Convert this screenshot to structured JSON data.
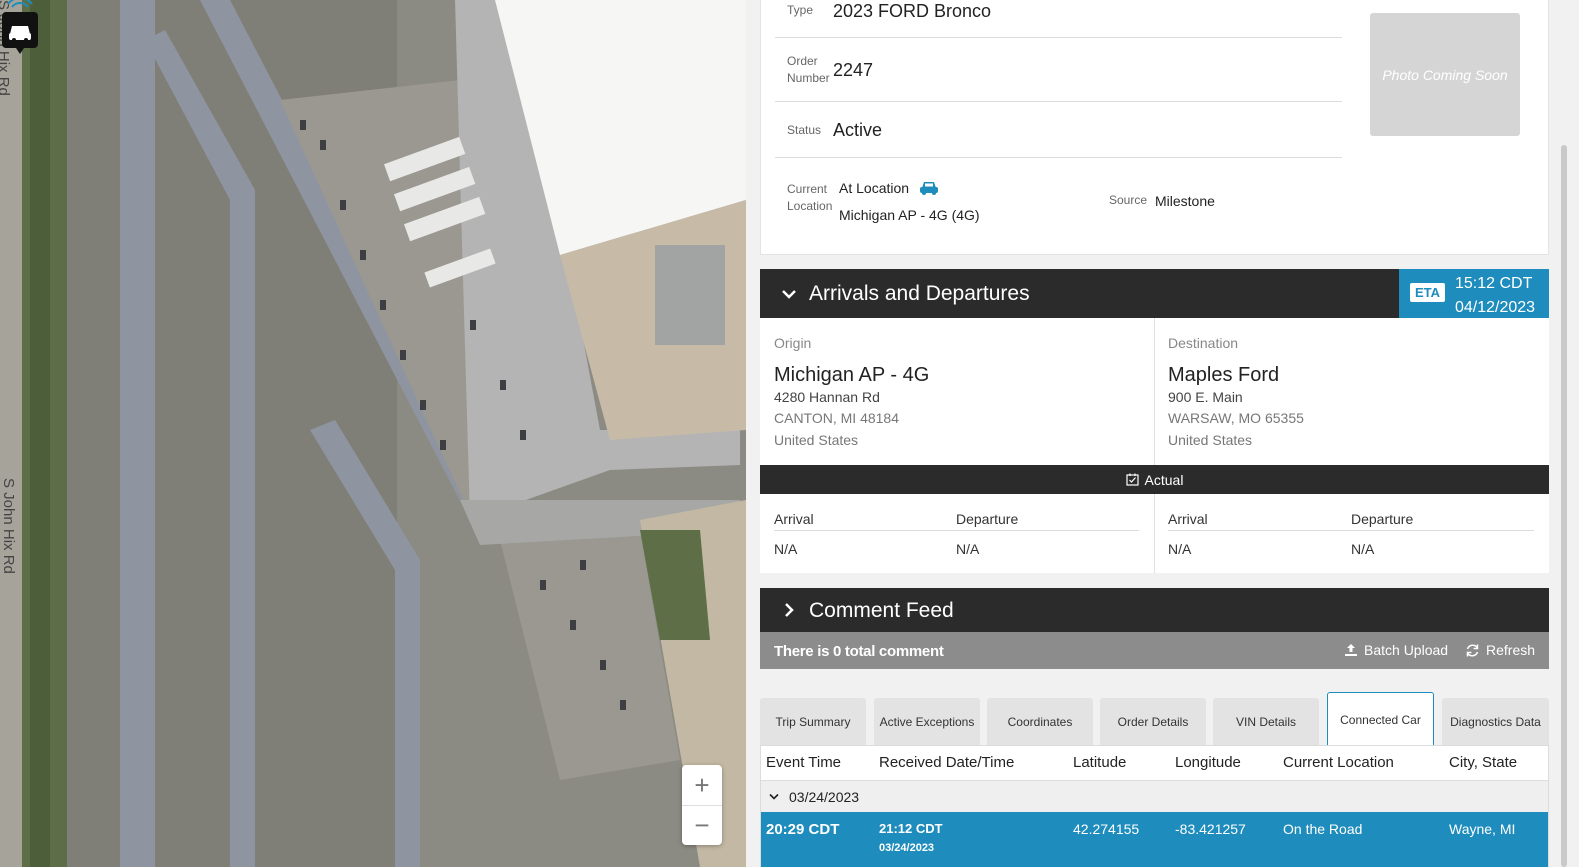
{
  "map": {
    "road_label_1": "S John Hix Rd",
    "road_label_2": "S John Hix Rd",
    "zoom_in": "+",
    "zoom_out": "−"
  },
  "vehicle": {
    "type_label": "Type",
    "type_value": "2023 FORD Bronco",
    "order_label_line1": "Order",
    "order_label_line2": "Number",
    "order_value": "2247",
    "status_label": "Status",
    "status_value": "Active",
    "location_label_line1": "Current",
    "location_label_line2": "Location",
    "location_status": "At Location",
    "location_value": "Michigan AP - 4G (4G)",
    "source_label": "Source",
    "source_value": "Milestone",
    "photo_text": "Photo Coming Soon"
  },
  "arrivals": {
    "title": "Arrivals and Departures",
    "eta_badge": "ETA",
    "eta_time": "15:12 CDT",
    "eta_date": "04/12/2023",
    "origin": {
      "heading": "Origin",
      "name": "Michigan AP - 4G",
      "street": "4280 Hannan Rd",
      "city": "CANTON, MI 48184",
      "country": "United States"
    },
    "destination": {
      "heading": "Destination",
      "name": "Maples Ford",
      "street": "900 E. Main",
      "city": "WARSAW, MO 65355",
      "country": "United States"
    },
    "actual_label": "Actual",
    "origin_arrival_label": "Arrival",
    "origin_departure_label": "Departure",
    "origin_arrival_value": "N/A",
    "origin_departure_value": "N/A",
    "dest_arrival_label": "Arrival",
    "dest_departure_label": "Departure",
    "dest_arrival_value": "N/A",
    "dest_departure_value": "N/A"
  },
  "comments": {
    "title": "Comment Feed",
    "count_text": "There is 0 total comment",
    "batch_upload": "Batch Upload",
    "refresh": "Refresh"
  },
  "tabs": [
    {
      "label": "Trip Summary"
    },
    {
      "label": "Active Exceptions"
    },
    {
      "label": "Coordinates"
    },
    {
      "label": "Order Details"
    },
    {
      "label": "VIN Details"
    },
    {
      "label": "Connected Car",
      "active": true
    },
    {
      "label": "Diagnostics Data"
    }
  ],
  "table": {
    "headers": [
      "Event Time",
      "Received Date/Time",
      "Latitude",
      "Longitude",
      "Current Location",
      "City, State"
    ],
    "group_date": "03/24/2023",
    "rows": [
      {
        "event_time": "20:29 CDT",
        "received_time": "21:12 CDT",
        "received_date": "03/24/2023",
        "latitude": "42.274155",
        "longitude": "-83.421257",
        "location": "On the Road",
        "city_state": "Wayne, MI"
      }
    ]
  },
  "colors": {
    "accent": "#1e8cbc",
    "dark_bar": "#2b2b2b",
    "comment_strip": "#8c8c8c"
  }
}
